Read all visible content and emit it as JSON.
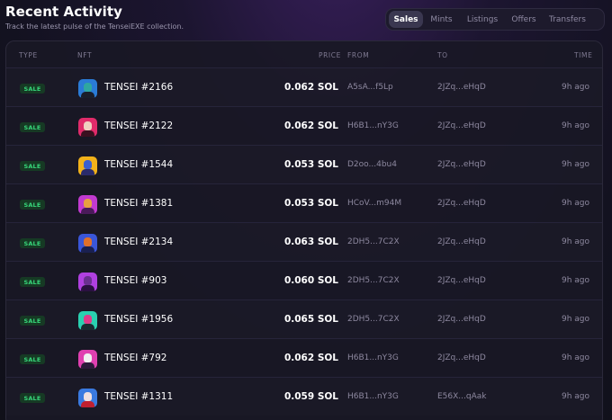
{
  "header": {
    "title": "Recent Activity",
    "subtitle": "Track the latest pulse of the TenseiEXE collection."
  },
  "tabs": [
    {
      "label": "Sales",
      "active": true
    },
    {
      "label": "Mints",
      "active": false
    },
    {
      "label": "Listings",
      "active": false
    },
    {
      "label": "Offers",
      "active": false
    },
    {
      "label": "Transfers",
      "active": false
    }
  ],
  "table": {
    "columns": {
      "type": "TYPE",
      "nft": "NFT",
      "price": "PRICE",
      "from": "FROM",
      "to": "TO",
      "time": "TIME"
    },
    "rows": [
      {
        "type": "SALE",
        "nft": "TENSEI #2166",
        "price": "0.062 SOL",
        "from": "A5sA...f5Lp",
        "to": "2JZq...eHqD",
        "time": "9h ago",
        "avatar_bg": "#2a7bd6",
        "avatar_skin": "#2fa7a0",
        "avatar_body": "#1a1e2a"
      },
      {
        "type": "SALE",
        "nft": "TENSEI #2122",
        "price": "0.062 SOL",
        "from": "H6B1...nY3G",
        "to": "2JZq...eHqD",
        "time": "9h ago",
        "avatar_bg": "#e02b6a",
        "avatar_skin": "#f0d0c0",
        "avatar_body": "#3a1020"
      },
      {
        "type": "SALE",
        "nft": "TENSEI #1544",
        "price": "0.053 SOL",
        "from": "D2oo...4bu4",
        "to": "2JZq...eHqD",
        "time": "9h ago",
        "avatar_bg": "#f2b21a",
        "avatar_skin": "#3a5fd0",
        "avatar_body": "#2a2a6a"
      },
      {
        "type": "SALE",
        "nft": "TENSEI #1381",
        "price": "0.053 SOL",
        "from": "HCoV...m94M",
        "to": "2JZq...eHqD",
        "time": "9h ago",
        "avatar_bg": "#c23ad0",
        "avatar_skin": "#e8a040",
        "avatar_body": "#4a1a5a"
      },
      {
        "type": "SALE",
        "nft": "TENSEI #2134",
        "price": "0.063 SOL",
        "from": "2DH5...7C2X",
        "to": "2JZq...eHqD",
        "time": "9h ago",
        "avatar_bg": "#3a56d8",
        "avatar_skin": "#e0702a",
        "avatar_body": "#1a2050"
      },
      {
        "type": "SALE",
        "nft": "TENSEI #903",
        "price": "0.060 SOL",
        "from": "2DH5...7C2X",
        "to": "2JZq...eHqD",
        "time": "9h ago",
        "avatar_bg": "#b040e0",
        "avatar_skin": "#6a3090",
        "avatar_body": "#2a1040"
      },
      {
        "type": "SALE",
        "nft": "TENSEI #1956",
        "price": "0.065 SOL",
        "from": "2DH5...7C2X",
        "to": "2JZq...eHqD",
        "time": "9h ago",
        "avatar_bg": "#2ad0b0",
        "avatar_skin": "#e03a8a",
        "avatar_body": "#1a2a30"
      },
      {
        "type": "SALE",
        "nft": "TENSEI #792",
        "price": "0.062 SOL",
        "from": "H6B1...nY3G",
        "to": "2JZq...eHqD",
        "time": "9h ago",
        "avatar_bg": "#e040b0",
        "avatar_skin": "#f0f0f0",
        "avatar_body": "#2a1a3a"
      },
      {
        "type": "SALE",
        "nft": "TENSEI #1311",
        "price": "0.059 SOL",
        "from": "H6B1...nY3G",
        "to": "E56X...qAak",
        "time": "9h ago",
        "avatar_bg": "#3a7ae0",
        "avatar_skin": "#f0e0e0",
        "avatar_body": "#c02030"
      }
    ]
  }
}
